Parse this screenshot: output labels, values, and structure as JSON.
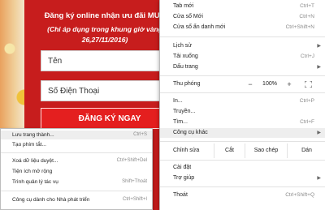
{
  "promo": {
    "title": "Đăng ký online nhận ưu đãi MUA",
    "subtitle_line1": "(Chỉ áp dụng trong khung giờ vàng",
    "subtitle_line2": "26,27/11/2016)",
    "name_placeholder": "Tên",
    "phone_placeholder": "Số Điện Thoại",
    "signup_button": "ĐĂNG KÝ NGAY"
  },
  "menu": {
    "new_tab": {
      "label": "Tab mới",
      "shortcut": "Ctrl+T"
    },
    "new_window": {
      "label": "Cửa sổ Mới",
      "shortcut": "Ctrl+N"
    },
    "incognito": {
      "label": "Cửa sổ ẩn danh mới",
      "shortcut": "Ctrl+Shift+N"
    },
    "history": {
      "label": "Lịch sử"
    },
    "downloads": {
      "label": "Tải xuống",
      "shortcut": "Ctrl+J"
    },
    "bookmarks": {
      "label": "Dấu trang"
    },
    "zoom": {
      "label": "Thu phóng",
      "minus": "−",
      "value": "100%",
      "plus": "+"
    },
    "print": {
      "label": "In...",
      "shortcut": "Ctrl+P"
    },
    "cast": {
      "label": "Truyền..."
    },
    "find": {
      "label": "Tìm...",
      "shortcut": "Ctrl+F"
    },
    "more_tools": {
      "label": "Công cụ khác"
    },
    "edit": {
      "label": "Chỉnh sửa",
      "cut": "Cắt",
      "copy": "Sao chép",
      "paste": "Dán"
    },
    "settings": {
      "label": "Cài đặt"
    },
    "help": {
      "label": "Trợ giúp"
    },
    "exit": {
      "label": "Thoát",
      "shortcut": "Ctrl+Shift+Q"
    }
  },
  "submenu": {
    "save_page": {
      "label": "Lưu trang thành...",
      "shortcut": "Ctrl+S"
    },
    "create_shortcut": {
      "label": "Tạo phím tắt..."
    },
    "clear_data": {
      "label": "Xoá dữ liệu duyệt...",
      "shortcut": "Ctrl+Shift+Del"
    },
    "extensions": {
      "label": "Tiện ích mở rộng"
    },
    "task_manager": {
      "label": "Trình quản lý tác vụ",
      "shortcut": "Shift+Thoát"
    },
    "dev_tools": {
      "label": "Công cụ dành cho Nhà phát triển",
      "shortcut": "Ctrl+Shift+I"
    }
  },
  "colors": {
    "promo_red": "#c71d1d",
    "button_red": "#e41f1f",
    "highlight": "#eeeeee"
  }
}
